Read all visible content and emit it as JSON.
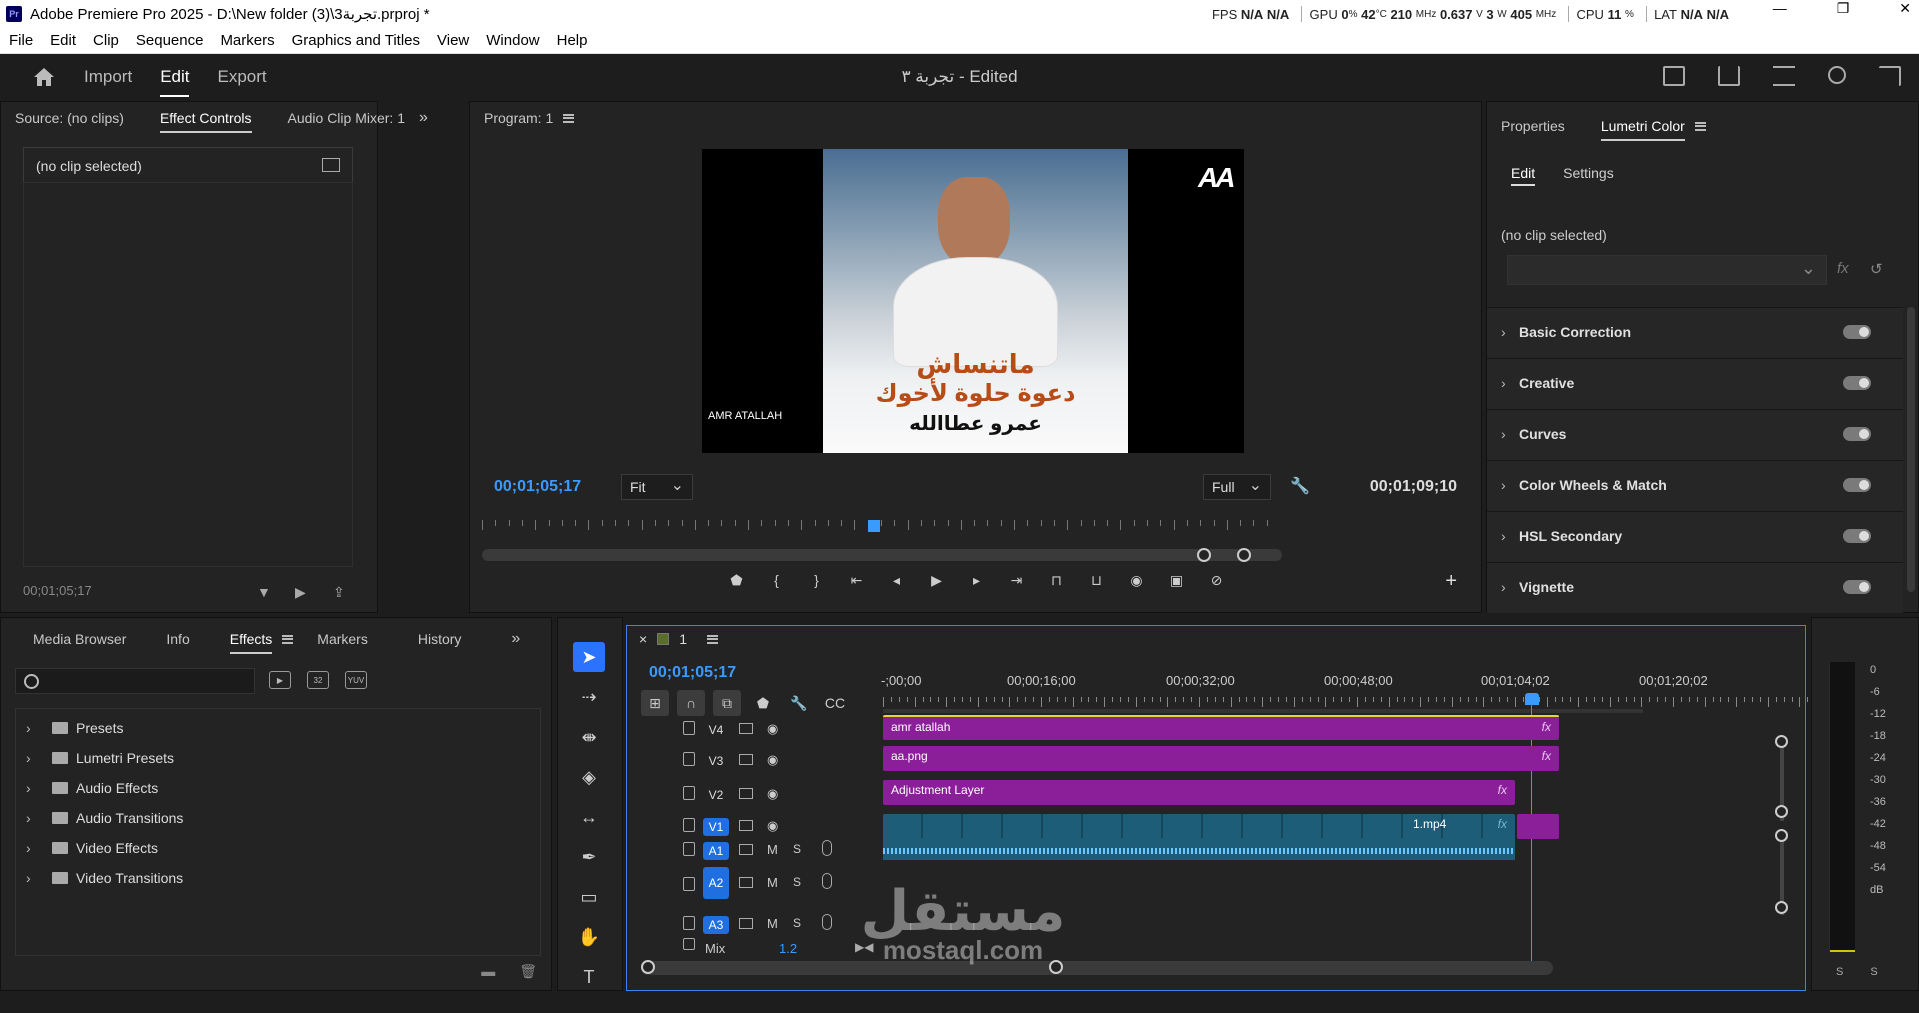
{
  "titlebar": {
    "logo": "Pr",
    "title": "Adobe Premiere Pro 2025 - D:\\New folder (3)\\3تجربة.prproj *",
    "perf": {
      "fps_label": "FPS",
      "fps_v1": "N/A",
      "fps_v2": "N/A",
      "gpu_label": "GPU",
      "gpu_pct": "0",
      "gpu_pct_unit": "%",
      "gpu_temp": "42",
      "gpu_temp_unit": "°C",
      "gpu_mhz": "210",
      "gpu_mhz_unit": "MHz",
      "gpu_volt": "0.637",
      "gpu_volt_unit": "V",
      "gpu_watt": "3",
      "gpu_watt_unit": "W",
      "gpu_mem": "405",
      "gpu_mem_unit": "MHz",
      "cpu_label": "CPU",
      "cpu_pct": "11",
      "cpu_pct_unit": "%",
      "lat_label": "LAT",
      "lat_v1": "N/A",
      "lat_v2": "N/A"
    },
    "controls": {
      "minimize": "—",
      "restore": "❐",
      "close": "✕"
    }
  },
  "menu": [
    "File",
    "Edit",
    "Clip",
    "Sequence",
    "Markers",
    "Graphics and Titles",
    "View",
    "Window",
    "Help"
  ],
  "workspace": {
    "tabs": [
      "Import",
      "Edit",
      "Export"
    ],
    "active_tab": "Edit",
    "project_title": "تجربة ٣ - Edited"
  },
  "source_panel": {
    "tabs": [
      "Source: (no clips)",
      "Effect Controls",
      "Audio Clip Mixer: 1"
    ],
    "more": "»",
    "no_clip": "(no clip selected)",
    "timecode": "00;01;05;17"
  },
  "program_panel": {
    "tab": "Program: 1",
    "overlay_title_line1": "ماتنساش",
    "overlay_title_line2": "دعوة حلوة لأخوك",
    "overlay_name": "عمرو عطاالله",
    "watermark_name": "AMR ATALLAH",
    "logo_text": "AA",
    "timecode_current": "00;01;05;17",
    "timecode_duration": "00;01;09;10",
    "fit_value": "Fit",
    "quality_value": "Full",
    "plus": "+"
  },
  "lumetri": {
    "tabs": [
      "Properties",
      "Lumetri Color"
    ],
    "subtabs": [
      "Edit",
      "Settings"
    ],
    "no_clip": "(no clip selected)",
    "fx": "fx",
    "reset": "↺",
    "sections": [
      "Basic Correction",
      "Creative",
      "Curves",
      "Color Wheels & Match",
      "HSL Secondary",
      "Vignette"
    ]
  },
  "effects_panel": {
    "tabs": [
      "Media Browser",
      "Info",
      "Effects",
      "Markers",
      "History"
    ],
    "more": "»",
    "search_value": "",
    "filter_icons": [
      "32",
      "YUV"
    ],
    "tree": [
      "Presets",
      "Lumetri Presets",
      "Audio Effects",
      "Audio Transitions",
      "Video Effects",
      "Video Transitions"
    ]
  },
  "timeline": {
    "close": "×",
    "sequence_name": "1",
    "timecode": "00;01;05;17",
    "ruler": [
      "-;00;00",
      "00;00;16;00",
      "00;00;32;00",
      "00;00;48;00",
      "00;01;04;02",
      "00;01;20;02"
    ],
    "video_tracks": [
      {
        "name": "V4",
        "clip": "amr atallah",
        "fx": "fx"
      },
      {
        "name": "V3",
        "clip": "aa.png",
        "fx": "fx"
      },
      {
        "name": "V2",
        "clip": "Adjustment Layer",
        "fx": "fx"
      },
      {
        "name": "V1",
        "clip": "1.mp4",
        "fx": "fx"
      }
    ],
    "audio_tracks": [
      {
        "name": "A1",
        "m": "M",
        "s": "S"
      },
      {
        "name": "A2",
        "m": "M",
        "s": "S"
      },
      {
        "name": "A3",
        "m": "M",
        "s": "S"
      }
    ],
    "mix_label": "Mix",
    "mix_value": "1.2"
  },
  "meter": {
    "scale": [
      "0",
      "-6",
      "-12",
      "-18",
      "-24",
      "-30",
      "-36",
      "-42",
      "-48",
      "-54",
      "dB"
    ],
    "solo": "S S"
  },
  "watermark": {
    "arabic": "مستقل",
    "latin": "mostaql.com"
  }
}
